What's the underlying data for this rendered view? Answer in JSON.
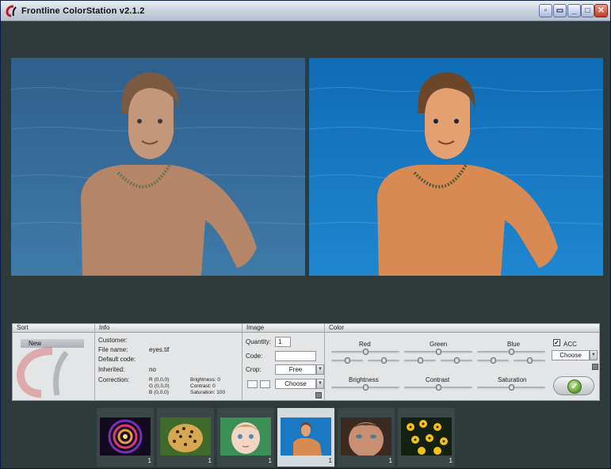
{
  "window": {
    "title": "Frontline ColorStation v2.1.2",
    "controls": [
      "extra-1",
      "extra-2",
      "minimize",
      "maximize",
      "close"
    ]
  },
  "panel": {
    "sort": {
      "header": "Sort",
      "items": [
        "New"
      ]
    },
    "info": {
      "header": "Info",
      "customer_label": "Customer:",
      "filename_label": "File name:",
      "filename_value": "eyes.tif",
      "default_code_label": "Default code:",
      "inherited_label": "Inherited:",
      "inherited_value": "no",
      "correction_label": "Correction:",
      "correction": {
        "r": "R (0,0,0)",
        "g": "G (0,0,0)",
        "b": "B (0,0,0)",
        "brightness": "Brightness: 0",
        "contrast": "Contrast: 0",
        "saturation": "Saturation: 100"
      }
    },
    "image": {
      "header": "Image",
      "quantity_label": "Quantity:",
      "quantity_value": "1",
      "code_label": "Code:",
      "code_value": "",
      "crop_label": "Crop:",
      "crop_value": "Free",
      "choose_value": "Choose"
    },
    "color": {
      "header": "Color",
      "red_label": "Red",
      "green_label": "Green",
      "blue_label": "Blue",
      "brightness_label": "Brightness",
      "contrast_label": "Contrast",
      "saturation_label": "Saturation",
      "acc_label": "ACC",
      "acc_checked": "✓",
      "choose_value": "Choose",
      "slider_levels": {
        "red_main": 0.5,
        "red_low": 0.5,
        "red_high": 0.5,
        "green_main": 0.5,
        "green_low": 0.5,
        "green_high": 0.5,
        "blue_main": 0.5,
        "blue_low": 0.5,
        "blue_high": 0.5,
        "brightness": 0.5,
        "contrast": 0.5,
        "saturation": 0.5
      }
    }
  },
  "thumbnails": [
    {
      "name": "spiral",
      "count": "1",
      "selected": false
    },
    {
      "name": "leopard",
      "count": "1",
      "selected": false
    },
    {
      "name": "baby",
      "count": "1",
      "selected": false
    },
    {
      "name": "boy-in-water",
      "count": "1",
      "selected": true
    },
    {
      "name": "girl-face",
      "count": "1",
      "selected": false
    },
    {
      "name": "yellow-flowers",
      "count": "1",
      "selected": false
    }
  ],
  "colors": {
    "background": "#2f3b3b",
    "panel": "#e4e5e6",
    "water_before": "#3d6f9a",
    "water_after": "#1e79c2",
    "ok_green": "#5d9b2e",
    "close_red": "#c53a22"
  }
}
